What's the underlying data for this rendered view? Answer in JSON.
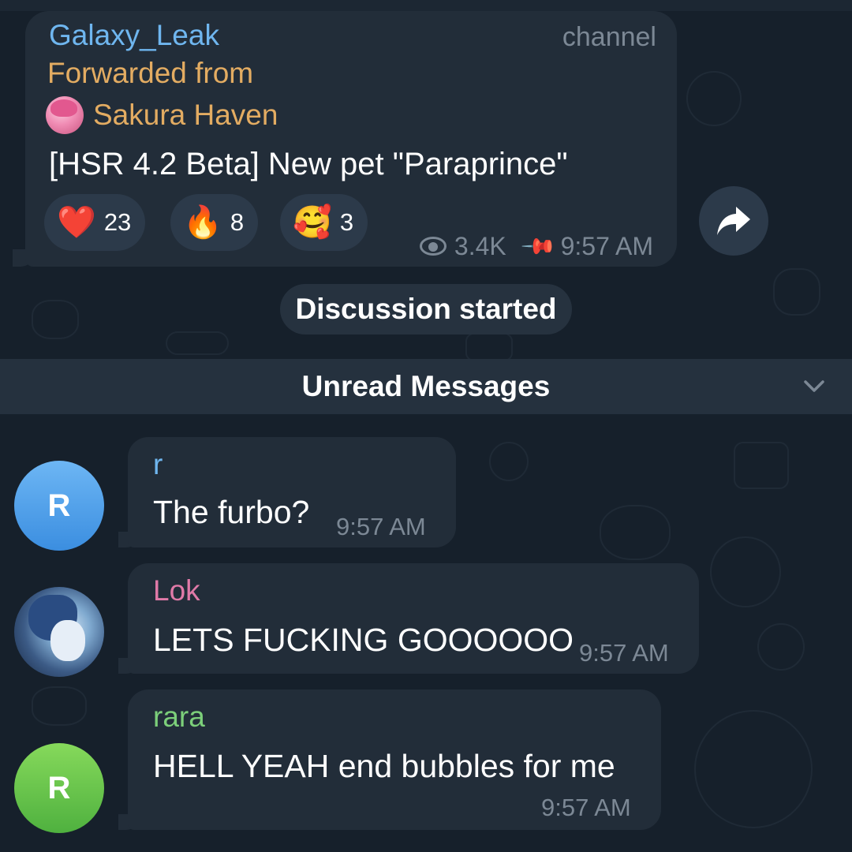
{
  "post": {
    "sender": "Galaxy_Leak",
    "tag": "channel",
    "forwarded_label": "Forwarded from",
    "origin_name": "Sakura Haven",
    "text": "[HSR 4.2 Beta] New pet \"Paraprince\"",
    "reactions": [
      {
        "emoji": "❤️",
        "count": "23"
      },
      {
        "emoji": "🔥",
        "count": "8"
      },
      {
        "emoji": "🥰",
        "count": "3"
      }
    ],
    "views": "3.4K",
    "time": "9:57 AM"
  },
  "service_message": "Discussion started",
  "unread_label": "Unread Messages",
  "messages": [
    {
      "sender": "r",
      "avatar_letter": "R",
      "text": "The furbo?",
      "time": "9:57 AM",
      "name_color": "#6fb6ef"
    },
    {
      "sender": "Lok",
      "text": "LETS FUCKING GOOOOOO",
      "time": "9:57 AM",
      "name_color": "#e07aa8"
    },
    {
      "sender": "rara",
      "avatar_letter": "R",
      "text": "HELL YEAH end bubbles for me",
      "time": "9:57 AM",
      "name_color": "#7ccf7a"
    }
  ],
  "icons": {
    "views": "eye-icon",
    "pinned": "pin-icon",
    "share": "share-arrow-icon",
    "unread_toggle": "chevron-down-icon"
  },
  "colors": {
    "background": "#16202b",
    "bubble": "#222d39",
    "channel_name": "#6fb6ef",
    "forward_text": "#e3ac62",
    "secondary_text": "#7c8895"
  }
}
